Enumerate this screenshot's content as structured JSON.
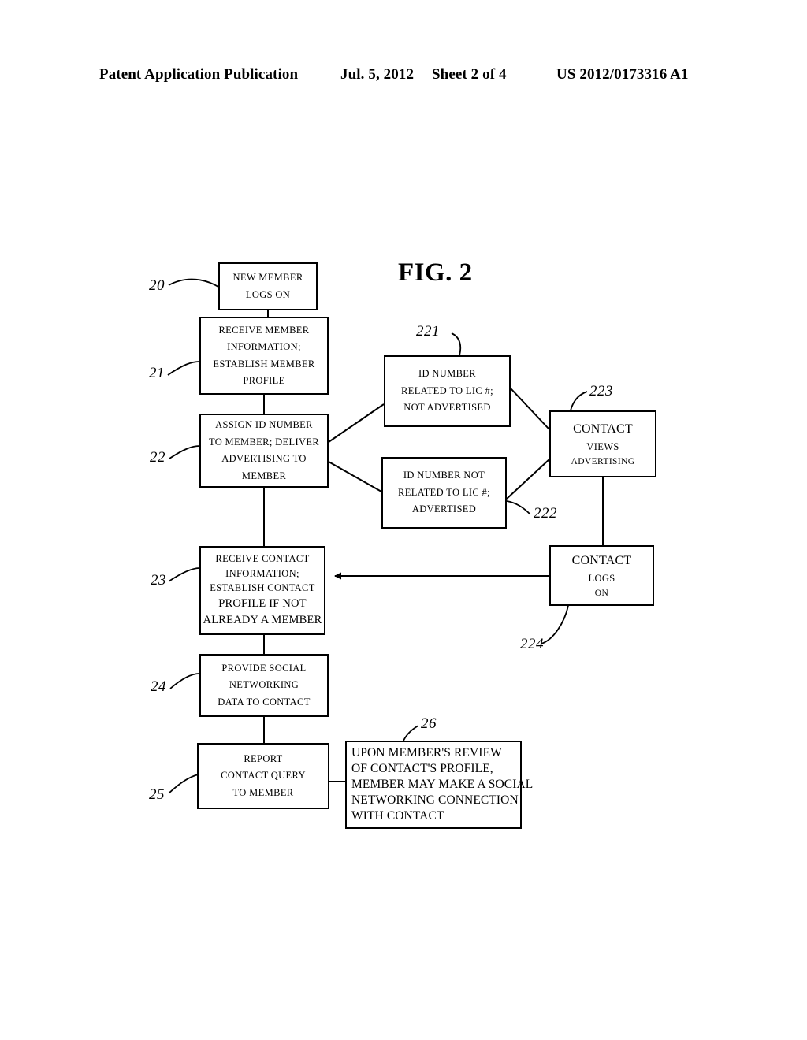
{
  "header": {
    "publication": "Patent Application Publication",
    "date": "Jul. 5, 2012",
    "sheet": "Sheet 2 of 4",
    "number": "US 2012/0173316 A1"
  },
  "figure": {
    "title": "FIG. 2",
    "boxes": {
      "b20": {
        "ref": "20",
        "lines": [
          "NEW MEMBER",
          "LOGS ON"
        ]
      },
      "b21": {
        "ref": "21",
        "lines": [
          "RECEIVE MEMBER",
          "INFORMATION;",
          "ESTABLISH MEMBER",
          "PROFILE"
        ]
      },
      "b22": {
        "ref": "22",
        "lines": [
          "ASSIGN ID NUMBER",
          "TO MEMBER; DELIVER",
          "ADVERTISING TO",
          "MEMBER"
        ]
      },
      "b23": {
        "ref": "23",
        "lines": [
          "RECEIVE CONTACT",
          "INFORMATION;",
          "ESTABLISH CONTACT",
          "PROFILE IF NOT",
          "ALREADY A MEMBER"
        ]
      },
      "b24": {
        "ref": "24",
        "lines": [
          "PROVIDE SOCIAL",
          "NETWORKING",
          "DATA TO CONTACT"
        ]
      },
      "b25": {
        "ref": "25",
        "lines": [
          "REPORT",
          "CONTACT QUERY",
          "TO MEMBER"
        ]
      },
      "b221": {
        "ref": "221",
        "lines": [
          "ID NUMBER",
          "RELATED TO LIC #;",
          "NOT ADVERTISED"
        ]
      },
      "b222": {
        "ref": "222",
        "lines": [
          "ID NUMBER NOT",
          "RELATED TO LIC #;",
          "ADVERTISED"
        ]
      },
      "b223": {
        "ref": "223",
        "lines": [
          "CONTACT",
          "VIEWS",
          "ADVERTISING"
        ]
      },
      "b224": {
        "ref": "224",
        "lines": [
          "CONTACT",
          "LOGS",
          "ON"
        ]
      },
      "b26": {
        "ref": "26",
        "lines": [
          "UPON MEMBER'S REVIEW",
          "OF CONTACT'S PROFILE,",
          "MEMBER MAY MAKE A SOCIAL",
          "NETWORKING CONNECTION",
          "WITH CONTACT"
        ]
      }
    }
  }
}
